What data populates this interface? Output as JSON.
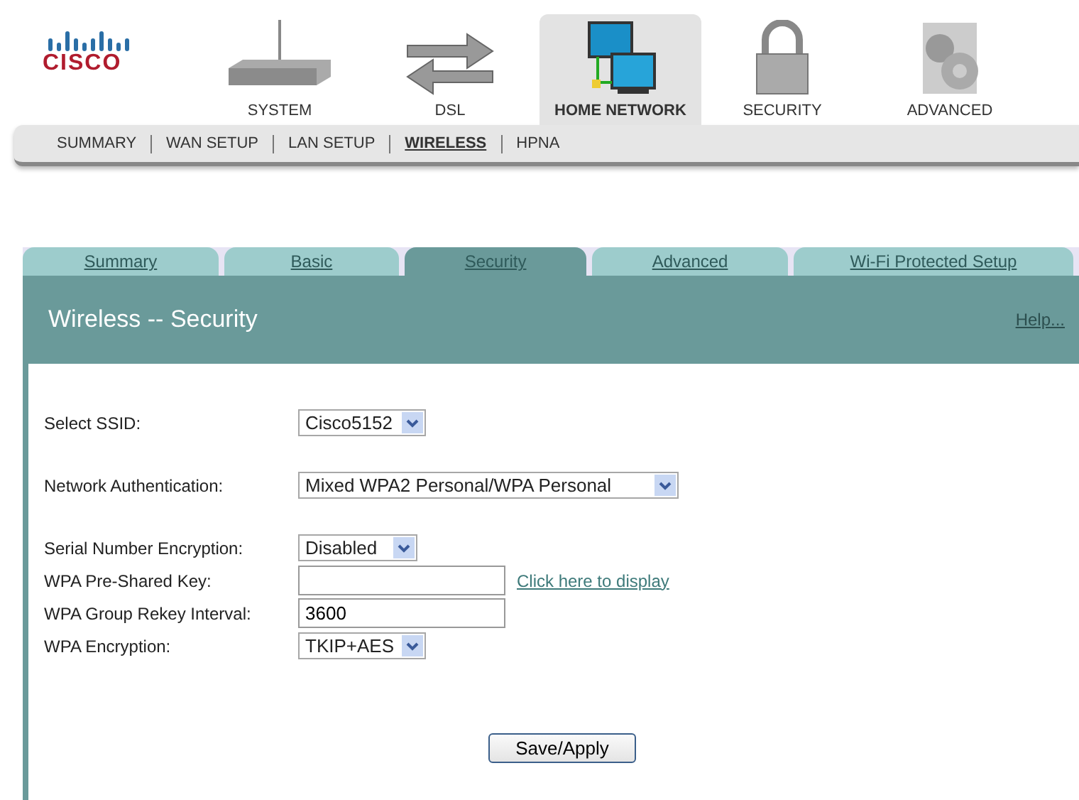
{
  "logo": {
    "text": "CISCO"
  },
  "main_nav": [
    {
      "label": "SYSTEM",
      "kind": "router",
      "selected": false
    },
    {
      "label": "DSL",
      "kind": "arrows",
      "selected": false
    },
    {
      "label": "HOME NETWORK",
      "kind": "network",
      "selected": true
    },
    {
      "label": "SECURITY",
      "kind": "lock",
      "selected": false
    },
    {
      "label": "ADVANCED",
      "kind": "gears",
      "selected": false
    }
  ],
  "sub_nav": [
    {
      "label": "SUMMARY",
      "selected": false
    },
    {
      "label": "WAN SETUP",
      "selected": false
    },
    {
      "label": "LAN SETUP",
      "selected": false
    },
    {
      "label": "WIRELESS",
      "selected": true
    },
    {
      "label": "HPNA",
      "selected": false
    }
  ],
  "tabs": [
    {
      "label": "Summary",
      "selected": false
    },
    {
      "label": "Basic",
      "selected": false
    },
    {
      "label": "Security",
      "selected": true
    },
    {
      "label": "Advanced",
      "selected": false
    },
    {
      "label": "Wi-Fi Protected Setup",
      "selected": false
    }
  ],
  "header": {
    "title": "Wireless -- Security",
    "help": "Help..."
  },
  "fields": [
    {
      "label": "Select SSID:",
      "kind": "select",
      "value": "Cisco5152"
    },
    {
      "label": "Network Authentication:",
      "kind": "select",
      "value": "Mixed WPA2 Personal/WPA Personal"
    },
    {
      "label": "Serial Number Encryption:",
      "kind": "select",
      "value": "Disabled"
    },
    {
      "label": "WPA Pre-Shared Key:",
      "kind": "text",
      "link": "Click here to display"
    },
    {
      "label": "WPA Group Rekey Interval:",
      "kind": "text",
      "value": "3600"
    },
    {
      "label": "WPA Encryption:",
      "kind": "select",
      "value": "TKIP+AES"
    }
  ],
  "save_button": "Save/Apply"
}
